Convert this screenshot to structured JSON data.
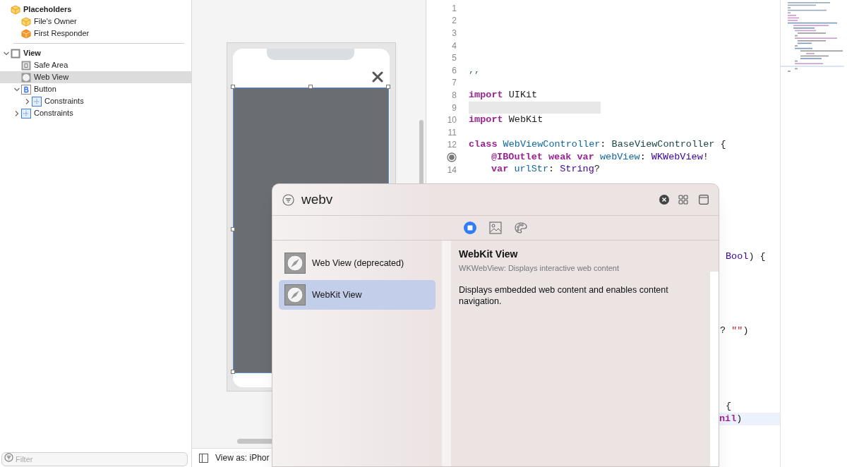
{
  "outline": [
    {
      "label": "Placeholders",
      "kind": "cube",
      "selected": false,
      "children": [
        {
          "label": "File's Owner",
          "kind": "cube",
          "selected": false
        },
        {
          "label": "First Responder",
          "kind": "responder",
          "selected": false
        }
      ]
    },
    {
      "label": "View",
      "kind": "view",
      "expanded": true,
      "selected": false,
      "children": [
        {
          "label": "Safe Area",
          "kind": "safearea",
          "selected": false
        },
        {
          "label": "Web View",
          "kind": "webview",
          "selected": true
        },
        {
          "label": "Button",
          "kind": "button",
          "expanded": true,
          "selected": false,
          "children": [
            {
              "label": "Constraints",
              "kind": "constraints",
              "expanded": false,
              "selected": false
            }
          ]
        },
        {
          "label": "Constraints",
          "kind": "constraints",
          "expanded": false,
          "selected": false
        }
      ]
    }
  ],
  "outline_filter": {
    "placeholder": "Filter"
  },
  "canvas": {
    "bottom_bar": {
      "label": "View as: iPhor"
    }
  },
  "code": {
    "lines": [
      {
        "number": "1"
      },
      {
        "number": "2"
      },
      {
        "number": "3"
      },
      {
        "number": "4"
      },
      {
        "number": "5"
      },
      {
        "number": "6",
        "tokens": [
          {
            "text": ",,",
            "kind": "comment"
          }
        ]
      },
      {
        "number": "7"
      },
      {
        "number": "8",
        "tokens": [
          {
            "text": "import",
            "kind": "keyword"
          },
          {
            "text": " UIKit",
            "kind": "plain"
          }
        ]
      },
      {
        "number": "9",
        "highlighted": true
      },
      {
        "number": "10",
        "tokens": [
          {
            "text": "import",
            "kind": "keyword"
          },
          {
            "text": " WebKit",
            "kind": "plain"
          }
        ]
      },
      {
        "number": "11"
      },
      {
        "number": "12",
        "tokens": [
          {
            "text": "class ",
            "kind": "keyword"
          },
          {
            "text": "WebViewController",
            "kind": "decl"
          },
          {
            "text": ": ",
            "kind": "plain"
          },
          {
            "text": "BaseViewController",
            "kind": "type"
          },
          {
            "text": " {",
            "kind": "plain"
          }
        ]
      },
      {
        "outlet": true,
        "indented": true,
        "tokens": [
          {
            "text": "@IBOutlet weak var ",
            "kind": "keyword"
          },
          {
            "text": "webView",
            "kind": "decl"
          },
          {
            "text": ": ",
            "kind": "plain"
          },
          {
            "text": "WKWebView",
            "kind": "systype"
          },
          {
            "text": "!",
            "kind": "plain"
          }
        ]
      },
      {
        "number": "14",
        "indented": true,
        "tokens": [
          {
            "text": "var ",
            "kind": "keyword"
          },
          {
            "text": "urlStr",
            "kind": "decl"
          },
          {
            "text": ": ",
            "kind": "plain"
          },
          {
            "text": "String",
            "kind": "systype"
          },
          {
            "text": "?",
            "kind": "plain"
          }
        ]
      }
    ],
    "fragments": [
      {
        "tokens": [
          {
            "text": "Bool",
            "kind": "systype"
          },
          {
            "text": ") {",
            "kind": "plain"
          }
        ]
      },
      {
        "tokens": [
          {
            "text": "? ",
            "kind": "plain"
          },
          {
            "text": "\"\"",
            "kind": "string"
          },
          {
            "text": ")",
            "kind": "plain"
          }
        ]
      },
      {
        "tokens": [
          {
            "text": "{",
            "kind": "plain"
          }
        ]
      },
      {
        "highlighted": true,
        "tokens": [
          {
            "text": "nil",
            "kind": "keyword"
          },
          {
            "text": ")",
            "kind": "plain"
          }
        ]
      }
    ]
  },
  "library": {
    "search": {
      "value": "webv"
    },
    "tabs": [
      {
        "kind": "objects",
        "selected": true
      },
      {
        "kind": "media",
        "selected": false
      },
      {
        "kind": "colors",
        "selected": false
      }
    ],
    "items": [
      {
        "label": "Web View (deprecated)",
        "selected": false
      },
      {
        "label": "WebKit View",
        "selected": true
      }
    ],
    "detail": {
      "title": "WebKit View",
      "subtitle": "WKWebView: Displays interactive web content",
      "description": "Displays embedded web content and enables content navigation."
    }
  }
}
